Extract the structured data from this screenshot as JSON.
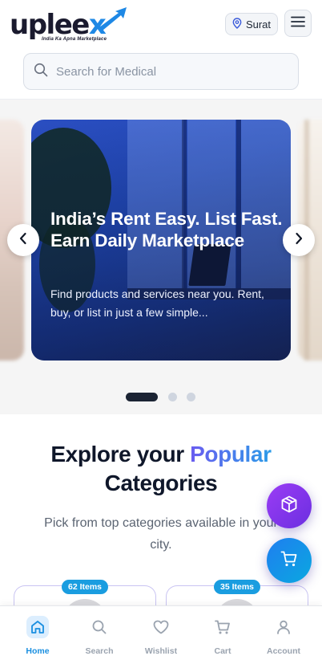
{
  "header": {
    "logo_text": "upleex",
    "logo_tagline": "India Ka Apna Marketplace",
    "location_label": "Surat",
    "location_icon": "map-pin-icon",
    "menu_icon": "hamburger-menu-icon"
  },
  "search": {
    "placeholder": "Search for Medical",
    "icon": "search-icon"
  },
  "hero": {
    "title": "India’s Rent Easy. List Fast. Earn Daily Marketplace",
    "subtitle": "Find products and services near you. Rent, buy, or list in just a few simple...",
    "prev_icon": "chevron-left-icon",
    "next_icon": "chevron-right-icon",
    "slide_count": 3,
    "active_slide": 1
  },
  "categories": {
    "title_part1": "Explore your ",
    "title_highlight": "Popular",
    "title_part2": "Categories",
    "subtitle": "Pick from top categories available in your city.",
    "cards": [
      {
        "badge": "62 Items"
      },
      {
        "badge": "35 Items"
      }
    ]
  },
  "fabs": {
    "box_icon": "package-icon",
    "cart_icon": "cart-icon"
  },
  "bottom_nav": {
    "items": [
      {
        "label": "Home",
        "icon": "home-icon",
        "active": true
      },
      {
        "label": "Search",
        "icon": "search-icon",
        "active": false
      },
      {
        "label": "Wishlist",
        "icon": "heart-icon",
        "active": false
      },
      {
        "label": "Cart",
        "icon": "cart-icon",
        "active": false
      },
      {
        "label": "Account",
        "icon": "user-icon",
        "active": false
      }
    ]
  },
  "colors": {
    "brand_blue": "#1a8fe0",
    "brand_dark": "#1a1a2e",
    "highlight_purple": "#6a5cf0",
    "fab_purple": "#7b36e8",
    "fab_blue": "#1f7ef0"
  }
}
